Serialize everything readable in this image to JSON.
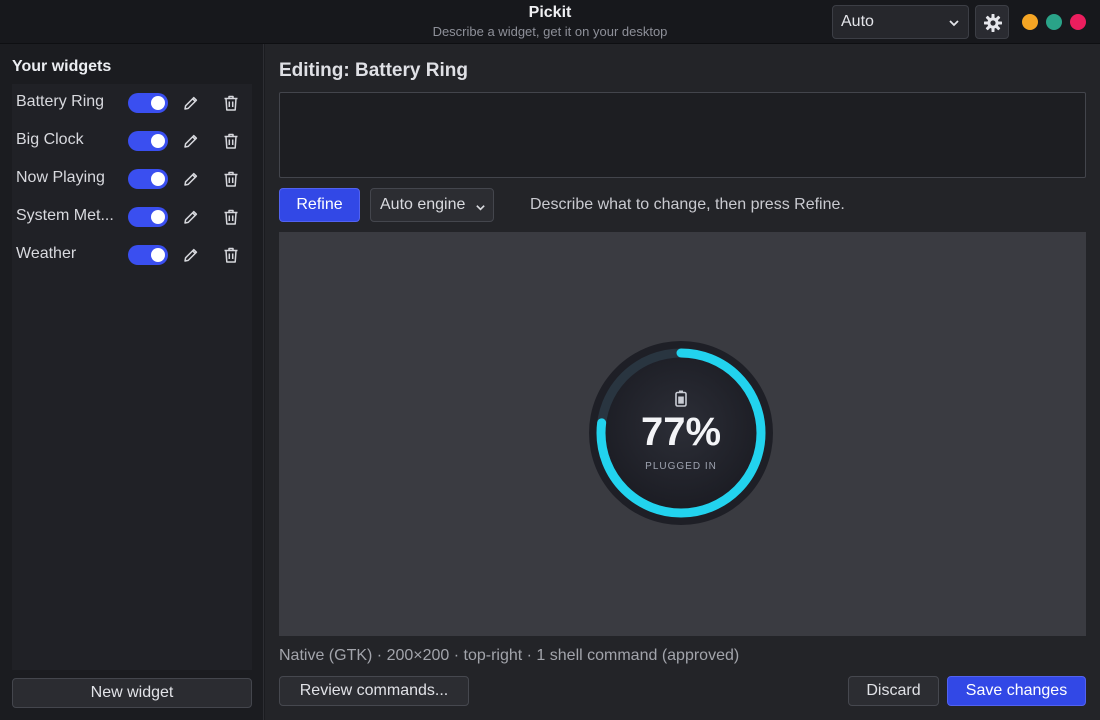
{
  "app": {
    "title": "Pickit",
    "subtitle": "Describe a widget, get it on your desktop",
    "engine_select": "Auto"
  },
  "icons": {
    "settings": "gear-icon",
    "dropdown": "chevron-down-icon",
    "edit": "pencil-icon",
    "delete": "trash-icon",
    "battery": "battery-icon"
  },
  "window_controls": {
    "minimize_color": "#f5a524",
    "maximize_color": "#2aa388",
    "close_color": "#ec1e5e"
  },
  "sidebar": {
    "title": "Your widgets",
    "widgets": [
      {
        "label": "Battery Ring",
        "enabled": true
      },
      {
        "label": "Big Clock",
        "enabled": true
      },
      {
        "label": "Now Playing",
        "enabled": true
      },
      {
        "label": "System Met...",
        "enabled": true
      },
      {
        "label": "Weather",
        "enabled": true
      }
    ],
    "new_widget_label": "New widget"
  },
  "editor": {
    "title": "Editing: Battery Ring",
    "description_value": "",
    "refine_label": "Refine",
    "engine_label": "Auto engine",
    "hint": "Describe what to change, then press Refine."
  },
  "preview": {
    "value_text": "77%",
    "value": 77,
    "status": "PLUGGED IN",
    "accent_color": "#22d3ee"
  },
  "footer": {
    "meta": "Native (GTK) · 200×200 · top-right · 1 shell command (approved)",
    "review_label": "Review commands...",
    "discard_label": "Discard",
    "save_label": "Save changes"
  },
  "colors": {
    "accent": "#3248e6"
  }
}
